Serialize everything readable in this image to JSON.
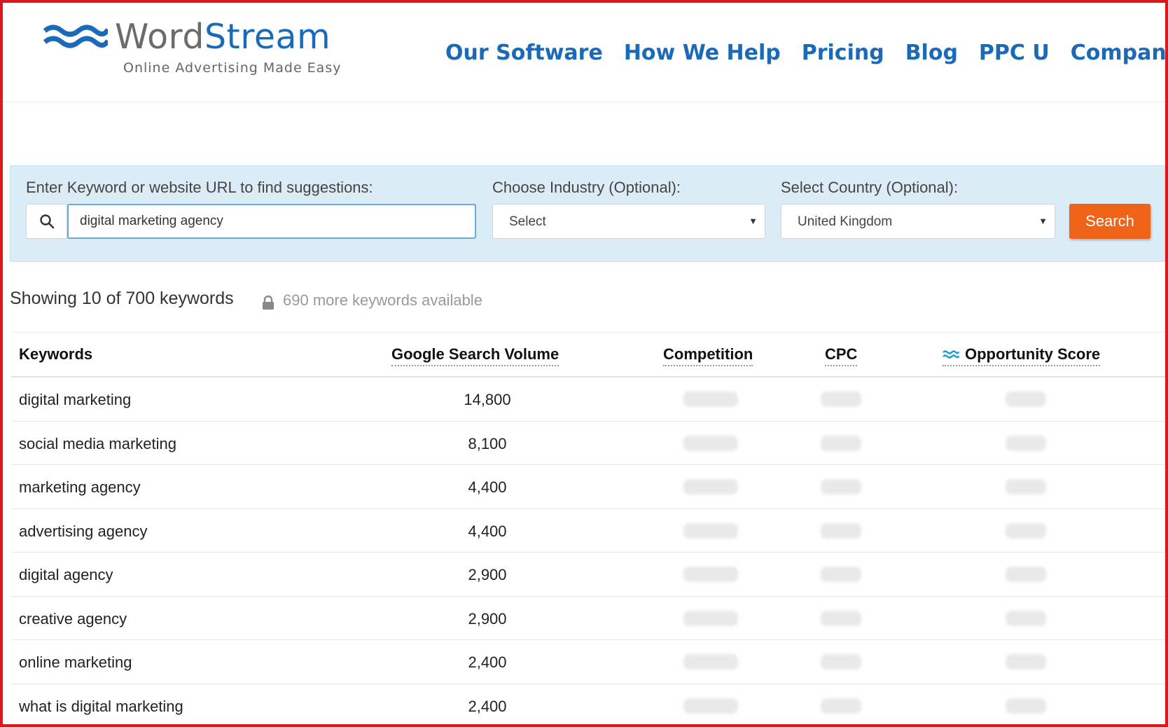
{
  "header": {
    "logo_word": "Word",
    "logo_stream": "Stream",
    "logo_tagline": "Online Advertising Made Easy",
    "nav": [
      {
        "label": "Our Software"
      },
      {
        "label": "How We Help"
      },
      {
        "label": "Pricing"
      },
      {
        "label": "Blog"
      },
      {
        "label": "PPC U"
      },
      {
        "label": "Company"
      }
    ],
    "brand_color": "#1a6ab8"
  },
  "search": {
    "keyword_label": "Enter Keyword or website URL to find suggestions:",
    "keyword_value": "digital marketing agency",
    "industry_label": "Choose Industry (Optional):",
    "industry_value": "Select",
    "country_label": "Select Country (Optional):",
    "country_value": "United Kingdom",
    "button_label": "Search",
    "button_color": "#ef6418"
  },
  "results": {
    "summary": "Showing 10 of 700 keywords",
    "more_available": "690 more keywords available"
  },
  "table": {
    "headers": {
      "keywords": "Keywords",
      "volume": "Google Search Volume",
      "competition": "Competition",
      "cpc": "CPC",
      "opportunity": "Opportunity Score"
    },
    "rows": [
      {
        "keyword": "digital marketing",
        "volume": "14,800"
      },
      {
        "keyword": "social media marketing",
        "volume": "8,100"
      },
      {
        "keyword": "marketing agency",
        "volume": "4,400"
      },
      {
        "keyword": "advertising agency",
        "volume": "4,400"
      },
      {
        "keyword": "digital agency",
        "volume": "2,900"
      },
      {
        "keyword": "creative agency",
        "volume": "2,900"
      },
      {
        "keyword": "online marketing",
        "volume": "2,400"
      },
      {
        "keyword": "what is digital marketing",
        "volume": "2,400"
      }
    ]
  }
}
